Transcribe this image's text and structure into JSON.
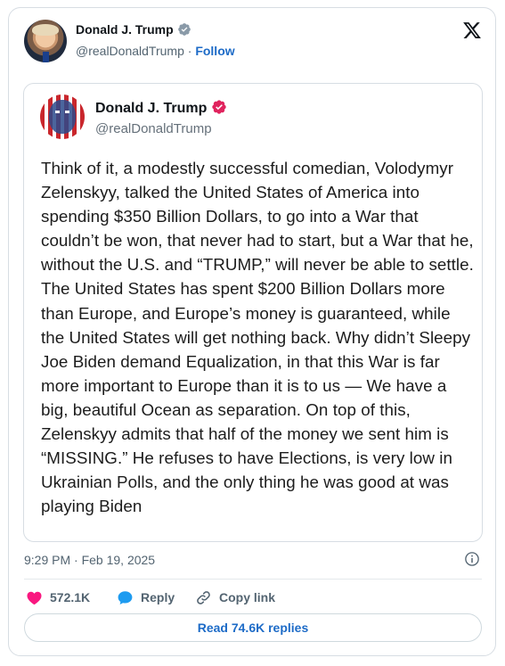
{
  "embed": {
    "author_name": "Donald J. Trump",
    "author_handle": "@realDonaldTrump",
    "separator": " · ",
    "follow_label": "Follow"
  },
  "quoted_post": {
    "author_name": "Donald J. Trump",
    "author_handle": "@realDonaldTrump",
    "text": "Think of it, a modestly successful comedian, Volodymyr Zelenskyy, talked the United States of America into spending $350 Billion Dollars, to go into a War that couldn’t be won, that never had to start, but a War that he, without the U.S. and “TRUMP,” will never be able to settle. The United States has spent $200 Billion Dollars more than Europe, and Europe’s money is guaranteed, while the United States will get nothing back. Why didn’t Sleepy Joe Biden demand Equalization, in that this War is far more important to Europe than it is to us — We have a big, beautiful Ocean as separation. On top of this, Zelenskyy admits that half of the money we sent him is “MISSING.” He refuses to have Elections, is very low in Ukrainian Polls, and the only thing he was good at was playing Biden"
  },
  "meta": {
    "timestamp": "9:29 PM · Feb 19, 2025"
  },
  "actions": {
    "likes_count": "572.1K",
    "reply_label": "Reply",
    "copy_link_label": "Copy link",
    "read_replies_label": "Read 74.6K replies"
  },
  "colors": {
    "accent": "#1d6bc7",
    "like": "#f91880",
    "verified_blue": "#8a9aa8",
    "verified_red": "#e0245e"
  },
  "icons": {
    "x_logo": "x-logo-icon",
    "verified": "verified-badge-icon",
    "info": "info-icon",
    "like": "heart-icon",
    "reply": "speech-bubble-icon",
    "copy": "link-icon"
  }
}
